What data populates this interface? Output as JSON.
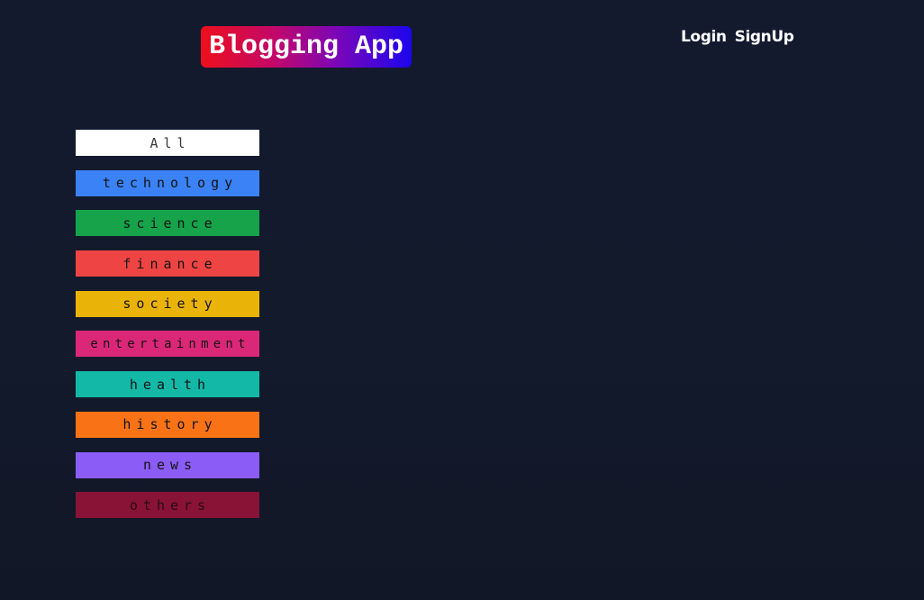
{
  "header": {
    "logo_text": "Blogging App",
    "login_label": "Login",
    "signup_label": "SignUp"
  },
  "categories": [
    {
      "label": "All",
      "color": "#ffffff"
    },
    {
      "label": "technology",
      "color": "#3b82f6"
    },
    {
      "label": "science",
      "color": "#16a34a"
    },
    {
      "label": "finance",
      "color": "#ef4444"
    },
    {
      "label": "society",
      "color": "#eab308"
    },
    {
      "label": "entertainment",
      "color": "#db2777"
    },
    {
      "label": "health",
      "color": "#14b8a6"
    },
    {
      "label": "history",
      "color": "#f97316"
    },
    {
      "label": "news",
      "color": "#8b5cf6"
    },
    {
      "label": "others",
      "color": "#881337"
    }
  ],
  "theme": {
    "background": "#131a2d",
    "logo_gradient_start": "#ee0f1c",
    "logo_gradient_end": "#1b06ee"
  }
}
